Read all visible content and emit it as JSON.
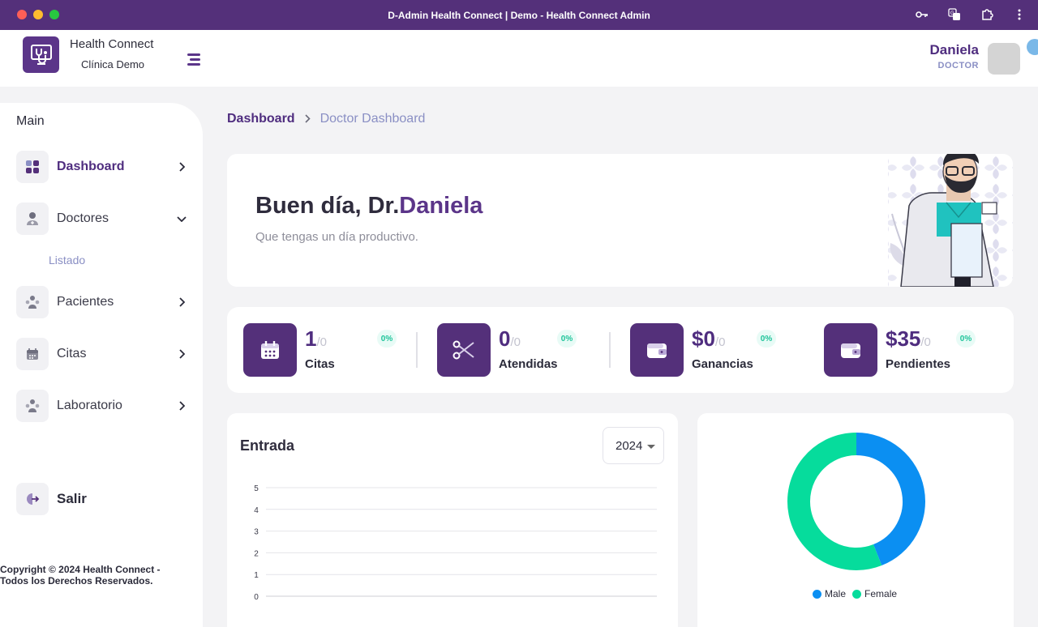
{
  "window": {
    "title": "D-Admin Health Connect | Demo - Health Connect Admin"
  },
  "header": {
    "brand_name": "Health Connect",
    "brand_sub": "Clínica Demo",
    "user_name": "Daniela",
    "user_role": "DOCTOR"
  },
  "sidebar": {
    "section_title": "Main",
    "items": [
      {
        "label": "Dashboard",
        "icon": "dashboard-icon",
        "active": true
      },
      {
        "label": "Doctores",
        "icon": "doctor-icon",
        "expanded": true
      },
      {
        "label": "Pacientes",
        "icon": "patients-icon"
      },
      {
        "label": "Citas",
        "icon": "calendar-icon"
      },
      {
        "label": "Laboratorio",
        "icon": "lab-icon"
      }
    ],
    "sub_item": "Listado",
    "logout": "Salir",
    "copyright": "Copyright © 2024 Health Connect - Todos los Derechos Reservados."
  },
  "breadcrumb": {
    "home": "Dashboard",
    "current": "Doctor Dashboard"
  },
  "welcome": {
    "greeting": "Buen día, Dr.",
    "name": "Daniela",
    "subtitle": "Que tengas un día productivo."
  },
  "stats": [
    {
      "value": "1",
      "of": "/0",
      "label": "Citas",
      "pct": "0%",
      "icon": "calendar-icon"
    },
    {
      "value": "0",
      "of": "/0",
      "label": "Atendidas",
      "pct": "0%",
      "icon": "scissors-icon"
    },
    {
      "value": "$0",
      "of": "/0",
      "label": "Ganancias",
      "pct": "0%",
      "icon": "wallet-icon"
    },
    {
      "value": "$35",
      "of": "/0",
      "label": "Pendientes",
      "pct": "0%",
      "icon": "wallet-icon"
    }
  ],
  "entrada": {
    "title": "Entrada",
    "year": "2024"
  },
  "colors": {
    "primary": "#54307a",
    "accent_blue": "#0b8ff2",
    "accent_green": "#06dc9c"
  },
  "chart_data": [
    {
      "type": "line",
      "title": "Entrada",
      "y_ticks": [
        "0",
        "1",
        "2",
        "3",
        "4",
        "5"
      ],
      "ylim": [
        0,
        5
      ],
      "series": [],
      "grid": true
    },
    {
      "type": "pie",
      "donut": true,
      "categories": [
        "Male",
        "Female"
      ],
      "values": [
        44,
        56
      ],
      "colors": [
        "#0b8ff2",
        "#06dc9c"
      ],
      "legend": "bottom"
    }
  ]
}
